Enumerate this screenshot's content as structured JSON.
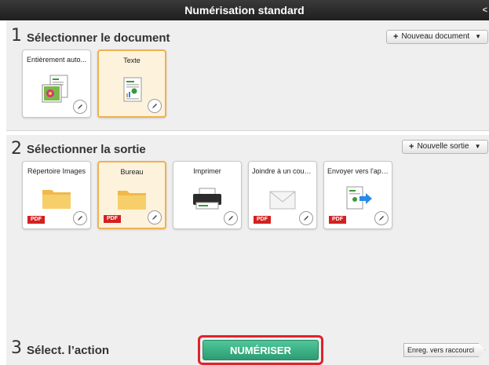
{
  "window": {
    "title": "Numérisation standard",
    "corner_glyph": "<"
  },
  "doc_section": {
    "number": "1",
    "title": "Sélectionner le document",
    "new_button": "Nouveau document",
    "tiles": [
      {
        "label": "Entièrement auto...",
        "icon": "photo-document-icon",
        "selected": false
      },
      {
        "label": "Texte",
        "icon": "text-document-icon",
        "selected": true
      }
    ]
  },
  "output_section": {
    "number": "2",
    "title": "Sélectionner la sortie",
    "new_button": "Nouvelle sortie",
    "badge": "PDF",
    "tiles": [
      {
        "label": "Répertoire Images",
        "icon": "folder-icon",
        "selected": false,
        "pdf": true
      },
      {
        "label": "Bureau",
        "icon": "folder-icon",
        "selected": true,
        "pdf": true
      },
      {
        "label": "Imprimer",
        "icon": "printer-icon",
        "selected": false,
        "pdf": false
      },
      {
        "label": "Joindre à un courriel",
        "icon": "envelope-icon",
        "selected": false,
        "pdf": true
      },
      {
        "label": "Envoyer vers l'appl...",
        "icon": "send-to-app-icon",
        "selected": false,
        "pdf": true
      }
    ]
  },
  "action_section": {
    "number": "3",
    "title": "Sélect. l’action",
    "scan_button": "NUMÉRISER",
    "shortcut_button": "Enreg. vers raccourci"
  },
  "colors": {
    "accent_selected": "#f0b050",
    "scan_green": "#3bb386",
    "highlight_red": "#e0222a",
    "pdf_red": "#d42020"
  }
}
